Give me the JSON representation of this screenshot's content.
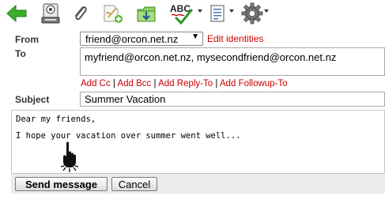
{
  "toolbar": {
    "items": [
      {
        "icon": "back-arrow-icon"
      },
      {
        "icon": "save-draft-icon"
      },
      {
        "icon": "attachment-paperclip-icon"
      },
      {
        "icon": "add-signature-icon"
      },
      {
        "icon": "insert-response-icon"
      },
      {
        "icon": "spellcheck-icon",
        "text": "ABC"
      },
      {
        "icon": "editor-type-icon"
      },
      {
        "icon": "options-gear-icon"
      }
    ]
  },
  "compose": {
    "from_label": "From",
    "from_value": "friend@orcon.net.nz",
    "from_arrow": "▼",
    "edit_identities": "Edit identities",
    "to_label": "To",
    "to_value": "myfriend@orcon.net.nz, mysecondfriend@orcon.net.nz",
    "add_links": [
      "Add Cc",
      "Add Bcc",
      "Add Reply-To",
      "Add Followup-To"
    ],
    "link_separator": "|",
    "subject_label": "Subject",
    "subject_value": "Summer Vacation",
    "body_lines": [
      "Dear my friends,",
      "I hope your vacation over summer went well..."
    ],
    "send_label": "Send message",
    "cancel_label": "Cancel"
  },
  "colors": {
    "link": "#cc0000",
    "back_arrow": "#3cae2c",
    "button_bar": "#ececec"
  }
}
